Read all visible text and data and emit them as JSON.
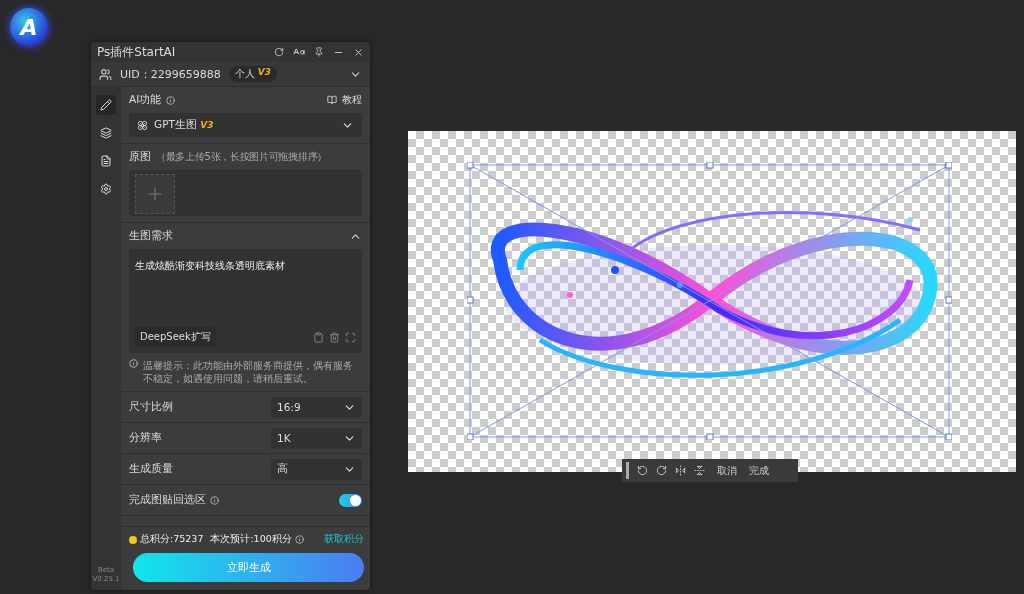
{
  "logo": {
    "letter": "A"
  },
  "panel": {
    "title": "Ps插件StartAI",
    "user": {
      "uid": "UID：2299659888",
      "plan": "个人",
      "plan_badge": "V3"
    },
    "sidebar": [
      {
        "kind": "pen",
        "selected": true
      },
      {
        "kind": "layers",
        "selected": false
      },
      {
        "kind": "doc",
        "selected": false
      },
      {
        "kind": "settings",
        "selected": false
      }
    ],
    "ai_function": {
      "label": "AI功能",
      "tutorial": "教程",
      "select": {
        "value": "GPT生图",
        "badge": "V3"
      }
    },
    "source_image": {
      "label": "原图",
      "hint": "（最多上传5张，长按图片可拖拽排序）"
    },
    "prompt": {
      "label": "生图需求",
      "expanded": true,
      "value": "生成炫酷渐变科技线条透明底素材",
      "expand_button": "DeepSeek扩写"
    },
    "notice": "温馨提示：此功能由外部服务商提供，偶有服务不稳定，如遇使用问题，请稍后重试。",
    "settings": [
      {
        "kind": "select",
        "label": "尺寸比例",
        "value": "16:9"
      },
      {
        "kind": "select",
        "label": "分辨率",
        "value": "1K"
      },
      {
        "kind": "select",
        "label": "生成质量",
        "value": "高"
      },
      {
        "kind": "toggle",
        "label": "完成图贴回选区",
        "on": true
      }
    ],
    "credits": {
      "total": "总积分:75237",
      "estimate": "本次预计:100积分",
      "link": "获取积分"
    },
    "generate_button": "立即生成",
    "version": {
      "tag": "Beta",
      "number": "V0.25.1"
    }
  },
  "canvas_toolbar": {
    "buttons": [
      {
        "kind": "rotate-left"
      },
      {
        "kind": "rotate-right"
      },
      {
        "kind": "flip-h"
      },
      {
        "kind": "flip-v"
      }
    ],
    "cancel": "取消",
    "done": "完成"
  }
}
